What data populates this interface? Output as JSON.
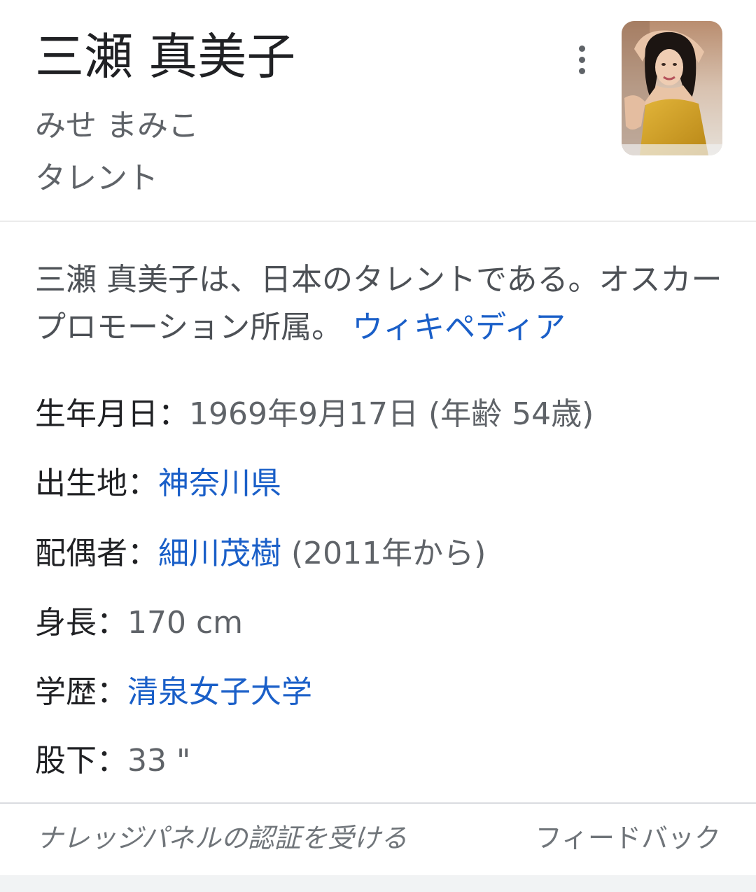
{
  "header": {
    "title": "三瀬 真美子",
    "reading": "みせ まみこ",
    "occupation": "タレント"
  },
  "description": {
    "text": "三瀬 真美子は、日本のタレントである。オスカープロモーション所属。",
    "source_link": "ウィキペディア"
  },
  "facts": [
    {
      "label": "生年月日：",
      "value": "1969年9月17日 (年齢 54歳)"
    },
    {
      "label": "出生地：",
      "link": "神奈川県"
    },
    {
      "label": "配偶者：",
      "link": "細川茂樹",
      "value": " (2011年から)"
    },
    {
      "label": "身長：",
      "value": "170 cm"
    },
    {
      "label": "学歴：",
      "link": "清泉女子大学"
    },
    {
      "label": "股下：",
      "value": "33 \""
    }
  ],
  "footer": {
    "claim": "ナレッジパネルの認証を受ける",
    "feedback": "フィードバック"
  },
  "colors": {
    "link": "#1a5fc8",
    "title": "#202124",
    "secondary": "#5f6368"
  },
  "icons": {
    "more": "more-vert-icon"
  }
}
